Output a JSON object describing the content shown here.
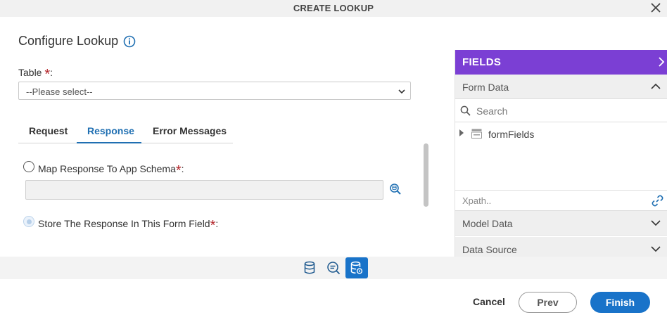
{
  "dialog": {
    "title": "CREATE LOOKUP"
  },
  "config": {
    "heading": "Configure Lookup",
    "table_label": "Table",
    "required_mark": "*",
    "colon": ":",
    "table_select_value": "--Please select--"
  },
  "tabs": [
    {
      "label": "Request",
      "active": false
    },
    {
      "label": "Response",
      "active": true
    },
    {
      "label": "Error Messages",
      "active": false
    }
  ],
  "response": {
    "option1_label": "Map Response To App Schema",
    "option1_selected": false,
    "option1_value": "",
    "option2_label": "Store The Response In This Form Field",
    "option2_selected": true
  },
  "fields_panel": {
    "title": "FIELDS",
    "form_data_label": "Form Data",
    "search_placeholder": "Search",
    "tree_items": [
      {
        "label": "formFields"
      }
    ],
    "xpath_placeholder": "Xpath..",
    "model_data_label": "Model Data",
    "data_source_label": "Data Source"
  },
  "footer": {
    "cancel": "Cancel",
    "prev": "Prev",
    "finish": "Finish"
  },
  "colors": {
    "accent": "#1973c9",
    "panel_header": "#7b3fd4",
    "required": "#b3262b",
    "active_tab": "#1f6fb2"
  }
}
